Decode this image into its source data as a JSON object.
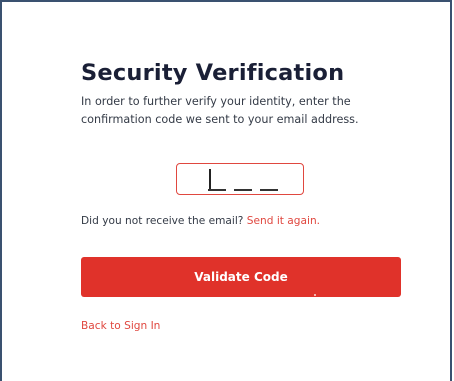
{
  "page": {
    "title": "Security Verification",
    "description": "In order to further verify your identity, enter the confirmation code we sent to your email address."
  },
  "code_input": {
    "value": "",
    "slots": 4
  },
  "resend": {
    "prompt": "Did you not receive the email?",
    "link": "Send it again."
  },
  "actions": {
    "validate_label": "Validate Code",
    "back_label": "Back to Sign In"
  },
  "colors": {
    "accent": "#e0322a",
    "link": "#e0473f",
    "frame": "#3a5170",
    "title": "#1a1f36"
  }
}
